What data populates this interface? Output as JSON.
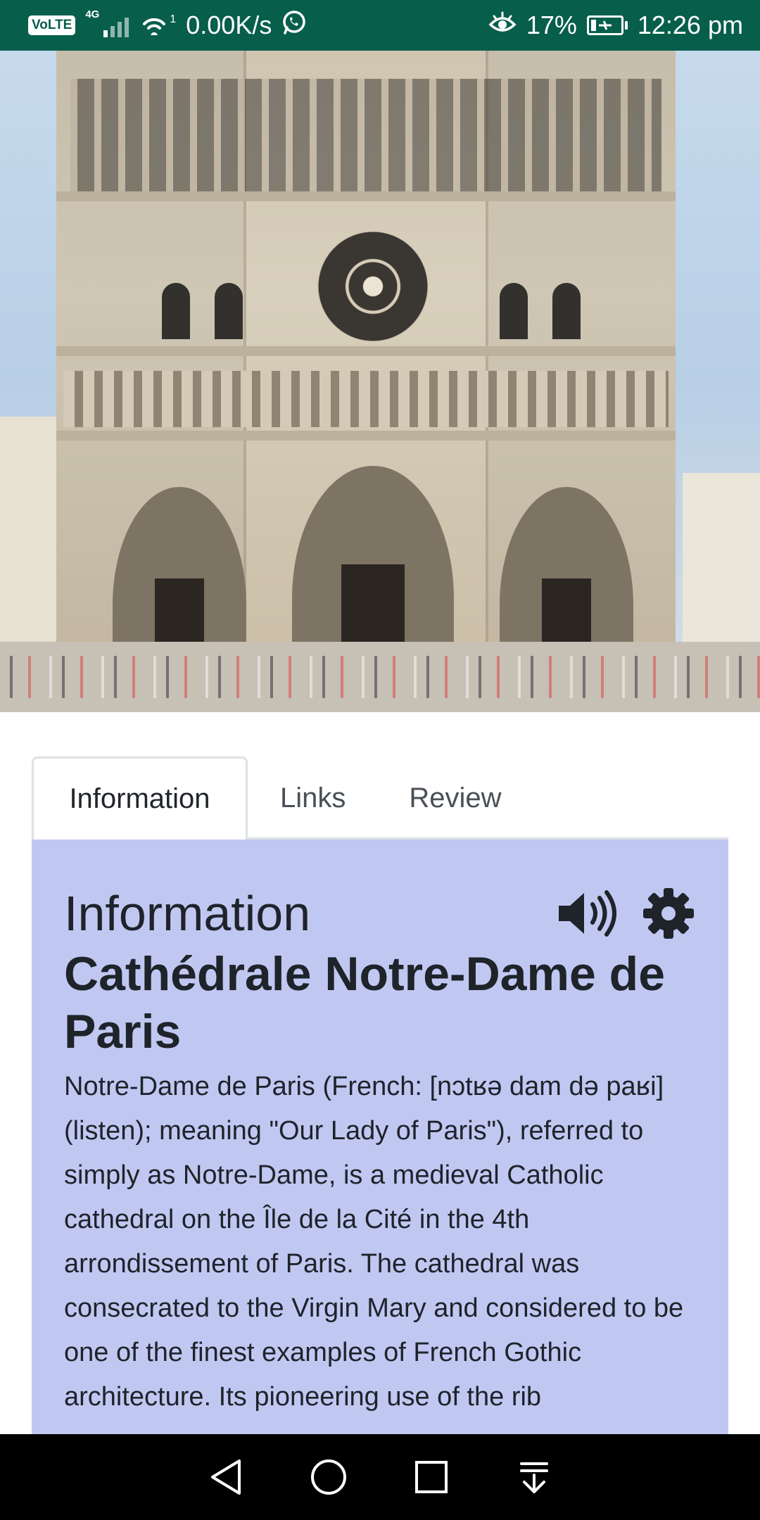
{
  "status_bar": {
    "volte": "VoLTE",
    "network": "4G",
    "hotspot_count": "1",
    "speed": "0.00K/s",
    "battery_percent": "17%",
    "battery_level": 0.17,
    "time": "12:26 pm",
    "icons": [
      "volte-icon",
      "signal-icon",
      "hotspot-icon",
      "whatsapp-icon",
      "eye-icon",
      "battery-charging-icon"
    ]
  },
  "hero": {
    "image": "notre-dame-facade"
  },
  "tabs": [
    {
      "label": "Information",
      "active": true
    },
    {
      "label": "Links",
      "active": false
    },
    {
      "label": "Review",
      "active": false
    }
  ],
  "panel": {
    "title": "Information",
    "heading": "Cathédrale Notre-Dame de Paris",
    "body": "Notre-Dame de Paris (French: [nɔtʁə dam də paʁi] (listen); meaning \"Our Lady of Paris\"), referred to simply as Notre-Dame, is a medieval Catholic cathedral on the Île de la Cité in the 4th arrondissement of Paris. The cathedral was consecrated to the Virgin Mary and considered to be one of the finest examples of French Gothic architecture. Its pioneering use of the rib",
    "icons": [
      "speaker-icon",
      "gear-icon"
    ],
    "background_color": "#c0c8f2"
  },
  "nav_bar": {
    "icons": [
      "back-icon",
      "home-icon",
      "recents-icon",
      "notification-pull-icon"
    ]
  },
  "colors": {
    "status_bar": "#075e4b",
    "panel": "#c0c8f2",
    "nav_bar": "#000000"
  }
}
